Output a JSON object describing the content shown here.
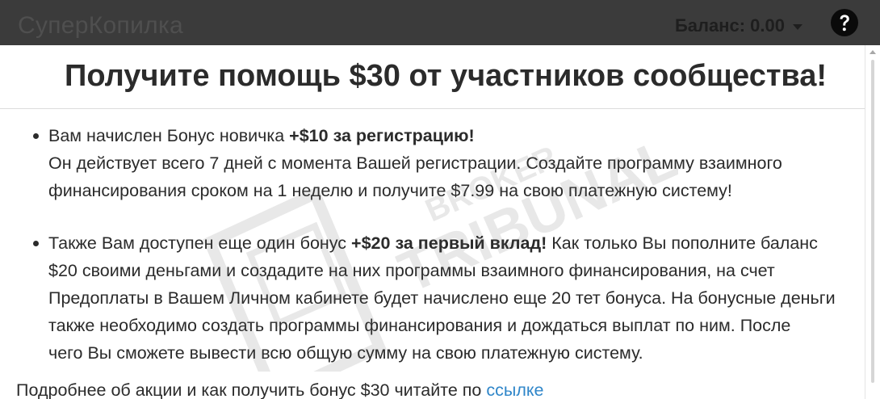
{
  "header": {
    "app_title": "СуперКопилка",
    "balance_label": "Баланс: 0.00"
  },
  "promo": {
    "title": "Получите помощь $30 от участников сообщества!"
  },
  "bonuses": [
    {
      "line1_prefix": "Вам начислен Бонус новичка ",
      "line1_bold": "+$10 за регистрацию!",
      "line1_suffix": "",
      "line2": "Он действует всего 7 дней с момента Вашей регистрации. Создайте программу взаимного",
      "line3": "финансирования сроком на 1 неделю и получите $7.99 на свою платежную систему!"
    },
    {
      "line1_prefix": "Также Вам доступен еще один бонус ",
      "line1_bold": "+$20 за первый вклад!",
      "line1_suffix": " Как только Вы пополните баланс",
      "line2": "$20 своими деньгами и создадите на них программы взаимного финансирования, на счет",
      "line3": "Предоплаты в Вашем Личном кабинете будет начислено еще 20 тет бонуса. На бонусные деньги",
      "line4": "также необходимо создать программы финансирования и дождаться выплат по ним. После",
      "line5": "чего Вы сможете вывести всю общую сумму на свою платежную систему."
    }
  ],
  "footer": {
    "text": "Подробнее об акции и как получить бонус $30 читайте по ",
    "link_label": "ссылке"
  },
  "watermark": {
    "line1": "BROKER",
    "line2": "TRIBUNAL"
  },
  "icons": {
    "help": "question-circle-icon",
    "balance_dropdown": "caret-down-icon"
  },
  "colors": {
    "topbar": "#3b3b3b",
    "text": "#2b2b2b",
    "link": "#2f86c9"
  }
}
